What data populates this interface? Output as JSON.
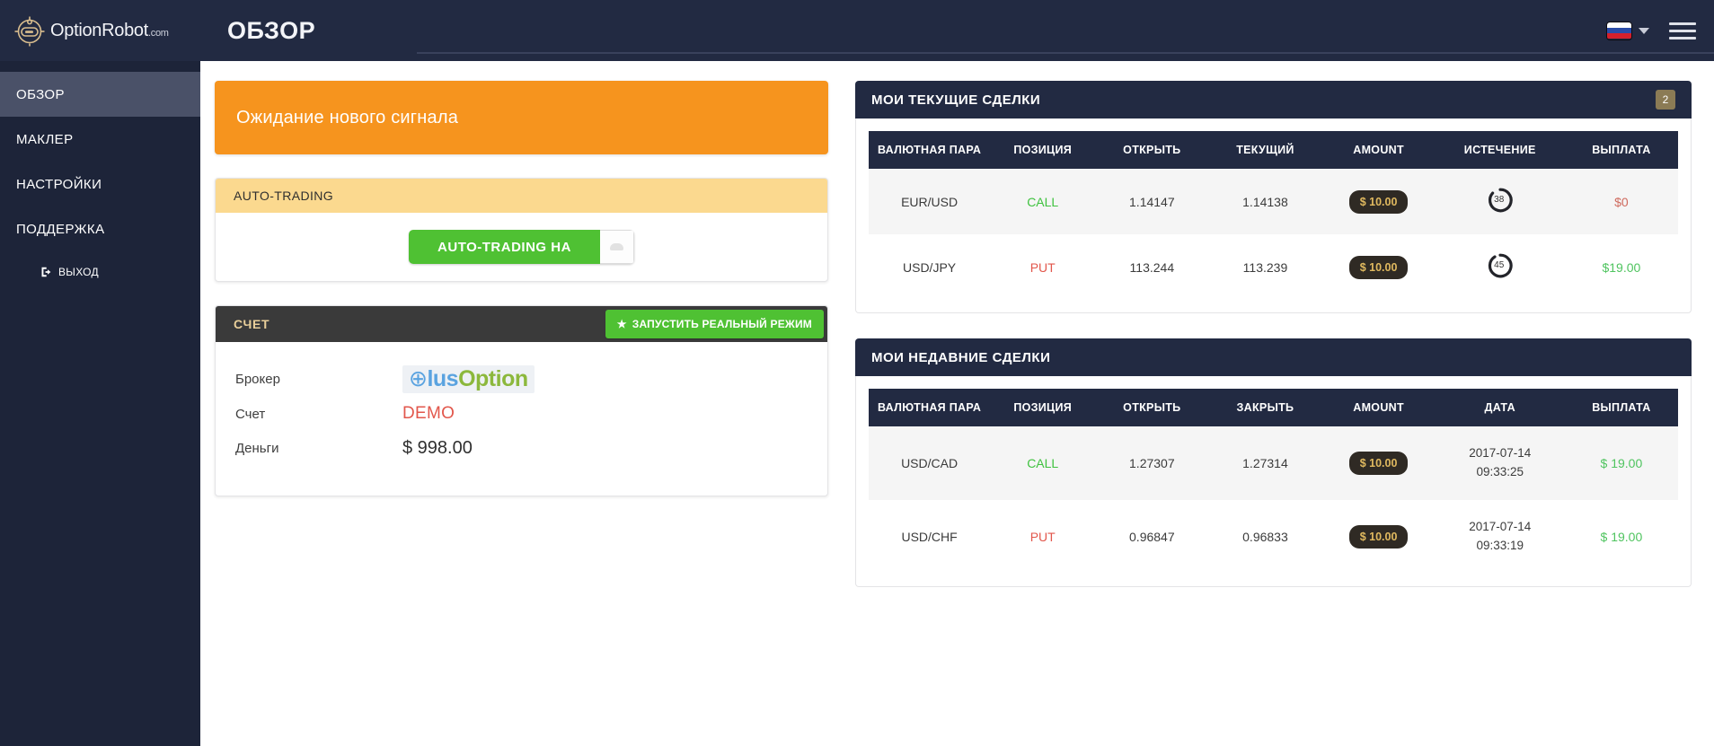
{
  "brand": {
    "name": "OptionRobot",
    "suffix": ".com"
  },
  "header": {
    "title": "ОБЗОР",
    "language": "ru"
  },
  "sidebar": {
    "items": [
      {
        "label": "ОБЗОР",
        "active": true
      },
      {
        "label": "МАКЛЕР",
        "active": false
      },
      {
        "label": "НАСТРОЙКИ",
        "active": false
      },
      {
        "label": "ПОДДЕРЖКА",
        "active": false
      }
    ],
    "logout": "ВЫХОД"
  },
  "signal": {
    "text": "Ожидание нового сигнала",
    "color": "#f6941e"
  },
  "autotrading": {
    "panel_title": "AUTO-TRADING",
    "toggle_label": "AUTO-TRADING НА",
    "state": "on",
    "color": "#4fc133"
  },
  "account": {
    "title": "СЧЕТ",
    "real_mode_button": "ЗАПУСТИТЬ РЕАЛЬНЫЙ РЕЖИМ",
    "rows": {
      "broker_label": "Брокер",
      "broker_value": "PlusOption",
      "account_label": "Счет",
      "account_value": "DEMO",
      "money_label": "Деньги",
      "money_value": "$ 998.00"
    }
  },
  "current_trades": {
    "title": "МОИ ТЕКУЩИЕ СДЕЛКИ",
    "count": "2",
    "columns": [
      "ВАЛЮТНАЯ ПАРА",
      "ПОЗИЦИЯ",
      "ОТКРЫТЬ",
      "ТЕКУЩИЙ",
      "AMOUNT",
      "ИСТЕЧЕНИЕ",
      "ВЫПЛАТА"
    ],
    "rows": [
      {
        "pair": "EUR/USD",
        "position": "CALL",
        "open": "1.14147",
        "current": "1.14138",
        "amount": "$ 10.00",
        "expiry": "38",
        "payout": "$0"
      },
      {
        "pair": "USD/JPY",
        "position": "PUT",
        "open": "113.244",
        "current": "113.239",
        "amount": "$ 10.00",
        "expiry": "45",
        "payout": "$19.00"
      }
    ]
  },
  "recent_trades": {
    "title": "МОИ НЕДАВНИЕ СДЕЛКИ",
    "columns": [
      "ВАЛЮТНАЯ ПАРА",
      "ПОЗИЦИЯ",
      "ОТКРЫТЬ",
      "ЗАКРЫТЬ",
      "AMOUNT",
      "ДАТА",
      "ВЫПЛАТА"
    ],
    "rows": [
      {
        "pair": "USD/CAD",
        "position": "CALL",
        "open": "1.27307",
        "close": "1.27314",
        "amount": "$ 10.00",
        "date": "2017-07-14",
        "time": "09:33:25",
        "payout": "$ 19.00"
      },
      {
        "pair": "USD/CHF",
        "position": "PUT",
        "open": "0.96847",
        "close": "0.96833",
        "amount": "$ 10.00",
        "date": "2017-07-14",
        "time": "09:33:19",
        "payout": "$ 19.00"
      }
    ]
  }
}
